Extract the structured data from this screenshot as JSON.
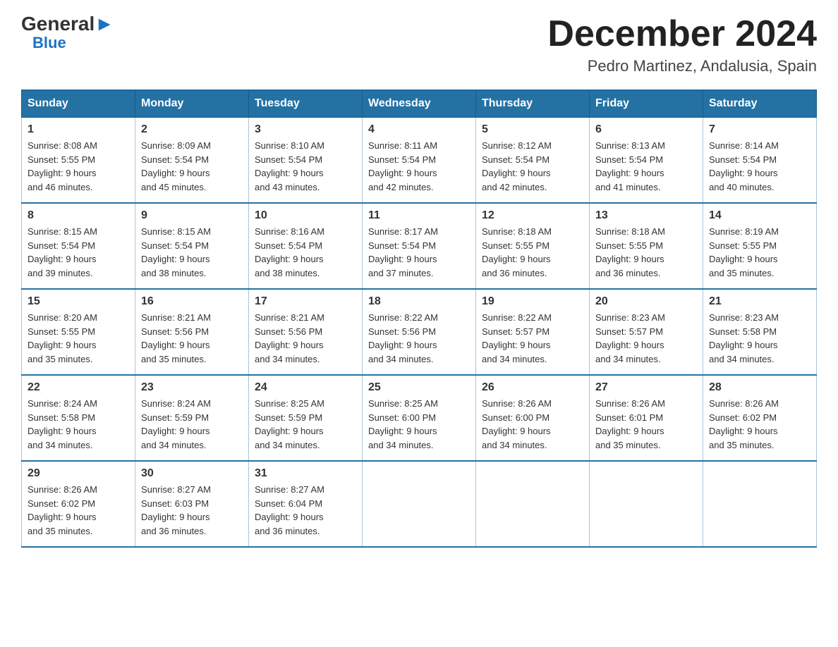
{
  "logo": {
    "general": "General",
    "blue": "Blue",
    "arrow": "▶"
  },
  "title": "December 2024",
  "location": "Pedro Martinez, Andalusia, Spain",
  "days_of_week": [
    "Sunday",
    "Monday",
    "Tuesday",
    "Wednesday",
    "Thursday",
    "Friday",
    "Saturday"
  ],
  "weeks": [
    [
      {
        "day": "1",
        "sunrise": "8:08 AM",
        "sunset": "5:55 PM",
        "daylight": "9 hours and 46 minutes."
      },
      {
        "day": "2",
        "sunrise": "8:09 AM",
        "sunset": "5:54 PM",
        "daylight": "9 hours and 45 minutes."
      },
      {
        "day": "3",
        "sunrise": "8:10 AM",
        "sunset": "5:54 PM",
        "daylight": "9 hours and 43 minutes."
      },
      {
        "day": "4",
        "sunrise": "8:11 AM",
        "sunset": "5:54 PM",
        "daylight": "9 hours and 42 minutes."
      },
      {
        "day": "5",
        "sunrise": "8:12 AM",
        "sunset": "5:54 PM",
        "daylight": "9 hours and 42 minutes."
      },
      {
        "day": "6",
        "sunrise": "8:13 AM",
        "sunset": "5:54 PM",
        "daylight": "9 hours and 41 minutes."
      },
      {
        "day": "7",
        "sunrise": "8:14 AM",
        "sunset": "5:54 PM",
        "daylight": "9 hours and 40 minutes."
      }
    ],
    [
      {
        "day": "8",
        "sunrise": "8:15 AM",
        "sunset": "5:54 PM",
        "daylight": "9 hours and 39 minutes."
      },
      {
        "day": "9",
        "sunrise": "8:15 AM",
        "sunset": "5:54 PM",
        "daylight": "9 hours and 38 minutes."
      },
      {
        "day": "10",
        "sunrise": "8:16 AM",
        "sunset": "5:54 PM",
        "daylight": "9 hours and 38 minutes."
      },
      {
        "day": "11",
        "sunrise": "8:17 AM",
        "sunset": "5:54 PM",
        "daylight": "9 hours and 37 minutes."
      },
      {
        "day": "12",
        "sunrise": "8:18 AM",
        "sunset": "5:55 PM",
        "daylight": "9 hours and 36 minutes."
      },
      {
        "day": "13",
        "sunrise": "8:18 AM",
        "sunset": "5:55 PM",
        "daylight": "9 hours and 36 minutes."
      },
      {
        "day": "14",
        "sunrise": "8:19 AM",
        "sunset": "5:55 PM",
        "daylight": "9 hours and 35 minutes."
      }
    ],
    [
      {
        "day": "15",
        "sunrise": "8:20 AM",
        "sunset": "5:55 PM",
        "daylight": "9 hours and 35 minutes."
      },
      {
        "day": "16",
        "sunrise": "8:21 AM",
        "sunset": "5:56 PM",
        "daylight": "9 hours and 35 minutes."
      },
      {
        "day": "17",
        "sunrise": "8:21 AM",
        "sunset": "5:56 PM",
        "daylight": "9 hours and 34 minutes."
      },
      {
        "day": "18",
        "sunrise": "8:22 AM",
        "sunset": "5:56 PM",
        "daylight": "9 hours and 34 minutes."
      },
      {
        "day": "19",
        "sunrise": "8:22 AM",
        "sunset": "5:57 PM",
        "daylight": "9 hours and 34 minutes."
      },
      {
        "day": "20",
        "sunrise": "8:23 AM",
        "sunset": "5:57 PM",
        "daylight": "9 hours and 34 minutes."
      },
      {
        "day": "21",
        "sunrise": "8:23 AM",
        "sunset": "5:58 PM",
        "daylight": "9 hours and 34 minutes."
      }
    ],
    [
      {
        "day": "22",
        "sunrise": "8:24 AM",
        "sunset": "5:58 PM",
        "daylight": "9 hours and 34 minutes."
      },
      {
        "day": "23",
        "sunrise": "8:24 AM",
        "sunset": "5:59 PM",
        "daylight": "9 hours and 34 minutes."
      },
      {
        "day": "24",
        "sunrise": "8:25 AM",
        "sunset": "5:59 PM",
        "daylight": "9 hours and 34 minutes."
      },
      {
        "day": "25",
        "sunrise": "8:25 AM",
        "sunset": "6:00 PM",
        "daylight": "9 hours and 34 minutes."
      },
      {
        "day": "26",
        "sunrise": "8:26 AM",
        "sunset": "6:00 PM",
        "daylight": "9 hours and 34 minutes."
      },
      {
        "day": "27",
        "sunrise": "8:26 AM",
        "sunset": "6:01 PM",
        "daylight": "9 hours and 35 minutes."
      },
      {
        "day": "28",
        "sunrise": "8:26 AM",
        "sunset": "6:02 PM",
        "daylight": "9 hours and 35 minutes."
      }
    ],
    [
      {
        "day": "29",
        "sunrise": "8:26 AM",
        "sunset": "6:02 PM",
        "daylight": "9 hours and 35 minutes."
      },
      {
        "day": "30",
        "sunrise": "8:27 AM",
        "sunset": "6:03 PM",
        "daylight": "9 hours and 36 minutes."
      },
      {
        "day": "31",
        "sunrise": "8:27 AM",
        "sunset": "6:04 PM",
        "daylight": "9 hours and 36 minutes."
      },
      null,
      null,
      null,
      null
    ]
  ],
  "labels": {
    "sunrise": "Sunrise:",
    "sunset": "Sunset:",
    "daylight": "Daylight:"
  }
}
